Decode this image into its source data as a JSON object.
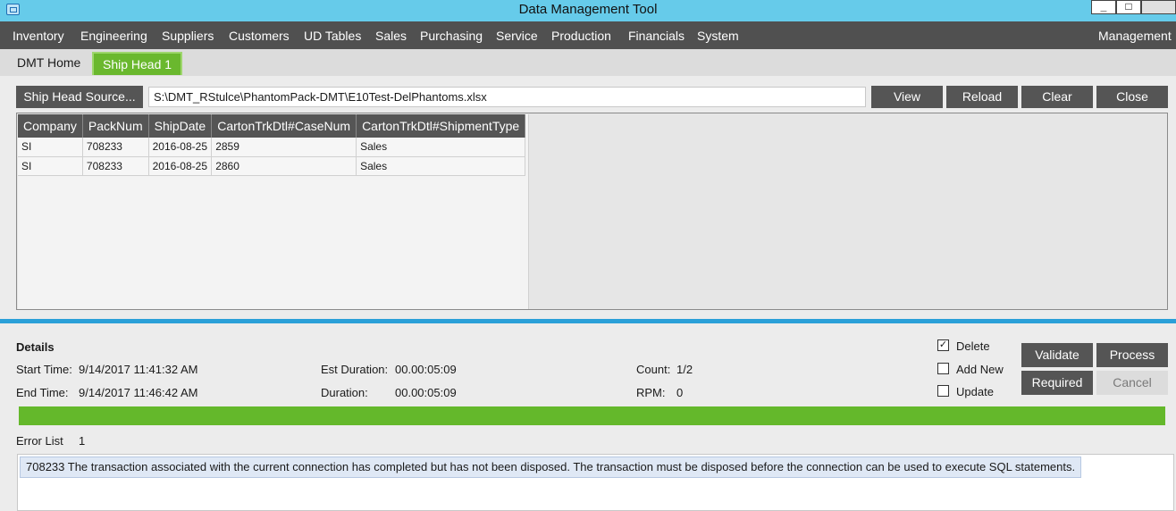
{
  "window": {
    "title": "Data Management Tool",
    "min_label": "_",
    "max_label": "□",
    "close_label": ""
  },
  "menu": {
    "items": [
      "Inventory",
      "Engineering",
      "Suppliers",
      "Customers",
      "UD Tables",
      "Sales",
      "Purchasing",
      "Service",
      "Production",
      "Financials",
      "System"
    ],
    "right": "Management"
  },
  "tabs": {
    "home": "DMT Home",
    "active": "Ship Head 1"
  },
  "toolbar": {
    "source_button": "Ship Head Source...",
    "path": "S:\\DMT_RStulce\\PhantomPack-DMT\\E10Test-DelPhantoms.xlsx",
    "view": "View",
    "reload": "Reload",
    "clear": "Clear",
    "close": "Close"
  },
  "grid": {
    "columns": [
      "Company",
      "PackNum",
      "ShipDate",
      "CartonTrkDtl#CaseNum",
      "CartonTrkDtl#ShipmentType"
    ],
    "rows": [
      [
        "SI",
        "708233",
        "2016-08-25",
        "2859",
        "Sales"
      ],
      [
        "SI",
        "708233",
        "2016-08-25",
        "2860",
        "Sales"
      ]
    ]
  },
  "details": {
    "heading": "Details",
    "start_label": "Start Time:",
    "start_value": "9/14/2017 11:41:32 AM",
    "end_label": "End Time:",
    "end_value": "9/14/2017 11:46:42 AM",
    "est_label": "Est Duration:",
    "est_value": "00.00:05:09",
    "dur_label": "Duration:",
    "dur_value": "00.00:05:09",
    "count_label": "Count:",
    "count_value": "1/2",
    "rpm_label": "RPM:",
    "rpm_value": "0"
  },
  "options": {
    "delete": {
      "label": "Delete",
      "checked": true
    },
    "add_new": {
      "label": "Add New",
      "checked": false
    },
    "update": {
      "label": "Update",
      "checked": false
    }
  },
  "actions": {
    "validate": "Validate",
    "process": "Process",
    "required": "Required",
    "cancel": "Cancel"
  },
  "progress": {
    "fraction": 1.0,
    "color": "#64b82b"
  },
  "errors": {
    "label": "Error List",
    "count": "1",
    "items": [
      "708233  The transaction associated with the current connection has completed but has not been disposed.  The transaction must be disposed before the connection can be used to execute SQL statements."
    ]
  },
  "colors": {
    "accent": "#66cbea",
    "menu": "#505050",
    "tab_active": "#6ab82e",
    "separator": "#2ba0d8"
  }
}
